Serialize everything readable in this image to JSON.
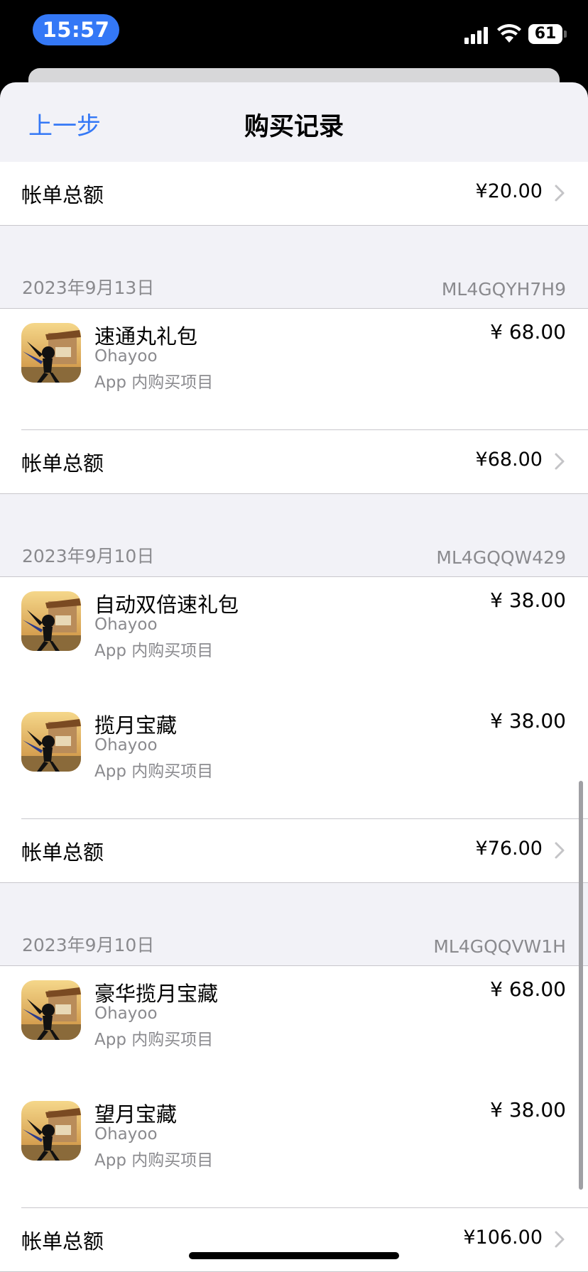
{
  "status": {
    "time": "15:57",
    "battery": "61"
  },
  "nav": {
    "back_label": "上一步",
    "title": "购买记录"
  },
  "total_label": "帐单总额",
  "top_total": "¥20.00",
  "sections": [
    {
      "date": "2023年9月13日",
      "order_id": "ML4GQYH7H9",
      "items": [
        {
          "name": "速通丸礼包",
          "developer": "Ohayoo",
          "type": "App 内购买项目",
          "price": "¥ 68.00"
        }
      ],
      "total": "¥68.00"
    },
    {
      "date": "2023年9月10日",
      "order_id": "ML4GQQW429",
      "items": [
        {
          "name": "自动双倍速礼包",
          "developer": "Ohayoo",
          "type": "App 内购买项目",
          "price": "¥ 38.00"
        },
        {
          "name": "揽月宝藏",
          "developer": "Ohayoo",
          "type": "App 内购买项目",
          "price": "¥ 38.00"
        }
      ],
      "total": "¥76.00"
    },
    {
      "date": "2023年9月10日",
      "order_id": "ML4GQQVW1H",
      "items": [
        {
          "name": "豪华揽月宝藏",
          "developer": "Ohayoo",
          "type": "App 内购买项目",
          "price": "¥ 68.00"
        },
        {
          "name": "望月宝藏",
          "developer": "Ohayoo",
          "type": "App 内购买项目",
          "price": "¥ 38.00"
        }
      ],
      "total": "¥106.00"
    }
  ],
  "colors": {
    "accent": "#3478f6",
    "secondary_text": "#8a8a8e",
    "background": "#f2f2f7"
  },
  "icons": {
    "app": "stickman-warrior-game-icon",
    "chevron": "chevron-right-icon"
  }
}
